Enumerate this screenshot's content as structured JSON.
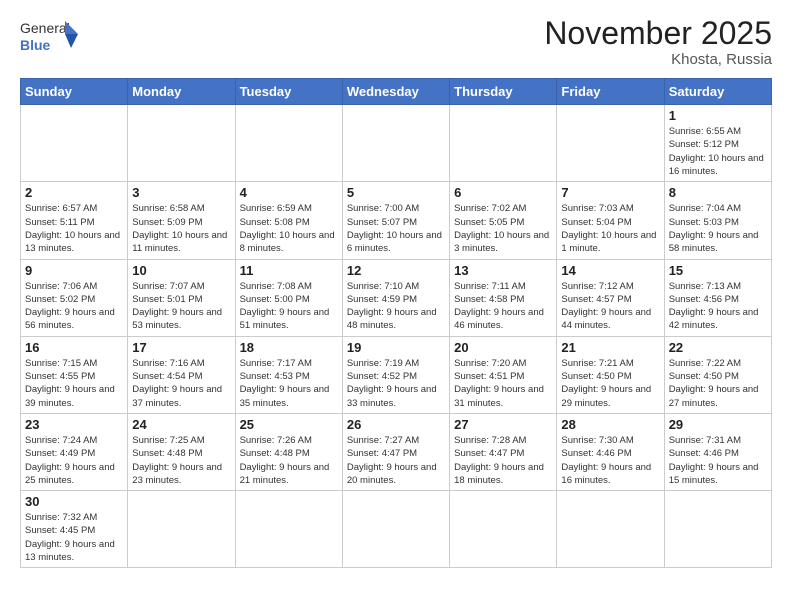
{
  "header": {
    "logo_general": "General",
    "logo_blue": "Blue",
    "month_title": "November 2025",
    "location": "Khosta, Russia"
  },
  "days_of_week": [
    "Sunday",
    "Monday",
    "Tuesday",
    "Wednesday",
    "Thursday",
    "Friday",
    "Saturday"
  ],
  "weeks": [
    [
      {
        "day": "",
        "info": ""
      },
      {
        "day": "",
        "info": ""
      },
      {
        "day": "",
        "info": ""
      },
      {
        "day": "",
        "info": ""
      },
      {
        "day": "",
        "info": ""
      },
      {
        "day": "",
        "info": ""
      },
      {
        "day": "1",
        "info": "Sunrise: 6:55 AM\nSunset: 5:12 PM\nDaylight: 10 hours and 16 minutes."
      }
    ],
    [
      {
        "day": "2",
        "info": "Sunrise: 6:57 AM\nSunset: 5:11 PM\nDaylight: 10 hours and 13 minutes."
      },
      {
        "day": "3",
        "info": "Sunrise: 6:58 AM\nSunset: 5:09 PM\nDaylight: 10 hours and 11 minutes."
      },
      {
        "day": "4",
        "info": "Sunrise: 6:59 AM\nSunset: 5:08 PM\nDaylight: 10 hours and 8 minutes."
      },
      {
        "day": "5",
        "info": "Sunrise: 7:00 AM\nSunset: 5:07 PM\nDaylight: 10 hours and 6 minutes."
      },
      {
        "day": "6",
        "info": "Sunrise: 7:02 AM\nSunset: 5:05 PM\nDaylight: 10 hours and 3 minutes."
      },
      {
        "day": "7",
        "info": "Sunrise: 7:03 AM\nSunset: 5:04 PM\nDaylight: 10 hours and 1 minute."
      },
      {
        "day": "8",
        "info": "Sunrise: 7:04 AM\nSunset: 5:03 PM\nDaylight: 9 hours and 58 minutes."
      }
    ],
    [
      {
        "day": "9",
        "info": "Sunrise: 7:06 AM\nSunset: 5:02 PM\nDaylight: 9 hours and 56 minutes."
      },
      {
        "day": "10",
        "info": "Sunrise: 7:07 AM\nSunset: 5:01 PM\nDaylight: 9 hours and 53 minutes."
      },
      {
        "day": "11",
        "info": "Sunrise: 7:08 AM\nSunset: 5:00 PM\nDaylight: 9 hours and 51 minutes."
      },
      {
        "day": "12",
        "info": "Sunrise: 7:10 AM\nSunset: 4:59 PM\nDaylight: 9 hours and 48 minutes."
      },
      {
        "day": "13",
        "info": "Sunrise: 7:11 AM\nSunset: 4:58 PM\nDaylight: 9 hours and 46 minutes."
      },
      {
        "day": "14",
        "info": "Sunrise: 7:12 AM\nSunset: 4:57 PM\nDaylight: 9 hours and 44 minutes."
      },
      {
        "day": "15",
        "info": "Sunrise: 7:13 AM\nSunset: 4:56 PM\nDaylight: 9 hours and 42 minutes."
      }
    ],
    [
      {
        "day": "16",
        "info": "Sunrise: 7:15 AM\nSunset: 4:55 PM\nDaylight: 9 hours and 39 minutes."
      },
      {
        "day": "17",
        "info": "Sunrise: 7:16 AM\nSunset: 4:54 PM\nDaylight: 9 hours and 37 minutes."
      },
      {
        "day": "18",
        "info": "Sunrise: 7:17 AM\nSunset: 4:53 PM\nDaylight: 9 hours and 35 minutes."
      },
      {
        "day": "19",
        "info": "Sunrise: 7:19 AM\nSunset: 4:52 PM\nDaylight: 9 hours and 33 minutes."
      },
      {
        "day": "20",
        "info": "Sunrise: 7:20 AM\nSunset: 4:51 PM\nDaylight: 9 hours and 31 minutes."
      },
      {
        "day": "21",
        "info": "Sunrise: 7:21 AM\nSunset: 4:50 PM\nDaylight: 9 hours and 29 minutes."
      },
      {
        "day": "22",
        "info": "Sunrise: 7:22 AM\nSunset: 4:50 PM\nDaylight: 9 hours and 27 minutes."
      }
    ],
    [
      {
        "day": "23",
        "info": "Sunrise: 7:24 AM\nSunset: 4:49 PM\nDaylight: 9 hours and 25 minutes."
      },
      {
        "day": "24",
        "info": "Sunrise: 7:25 AM\nSunset: 4:48 PM\nDaylight: 9 hours and 23 minutes."
      },
      {
        "day": "25",
        "info": "Sunrise: 7:26 AM\nSunset: 4:48 PM\nDaylight: 9 hours and 21 minutes."
      },
      {
        "day": "26",
        "info": "Sunrise: 7:27 AM\nSunset: 4:47 PM\nDaylight: 9 hours and 20 minutes."
      },
      {
        "day": "27",
        "info": "Sunrise: 7:28 AM\nSunset: 4:47 PM\nDaylight: 9 hours and 18 minutes."
      },
      {
        "day": "28",
        "info": "Sunrise: 7:30 AM\nSunset: 4:46 PM\nDaylight: 9 hours and 16 minutes."
      },
      {
        "day": "29",
        "info": "Sunrise: 7:31 AM\nSunset: 4:46 PM\nDaylight: 9 hours and 15 minutes."
      }
    ],
    [
      {
        "day": "30",
        "info": "Sunrise: 7:32 AM\nSunset: 4:45 PM\nDaylight: 9 hours and 13 minutes."
      },
      {
        "day": "",
        "info": ""
      },
      {
        "day": "",
        "info": ""
      },
      {
        "day": "",
        "info": ""
      },
      {
        "day": "",
        "info": ""
      },
      {
        "day": "",
        "info": ""
      },
      {
        "day": "",
        "info": ""
      }
    ]
  ]
}
